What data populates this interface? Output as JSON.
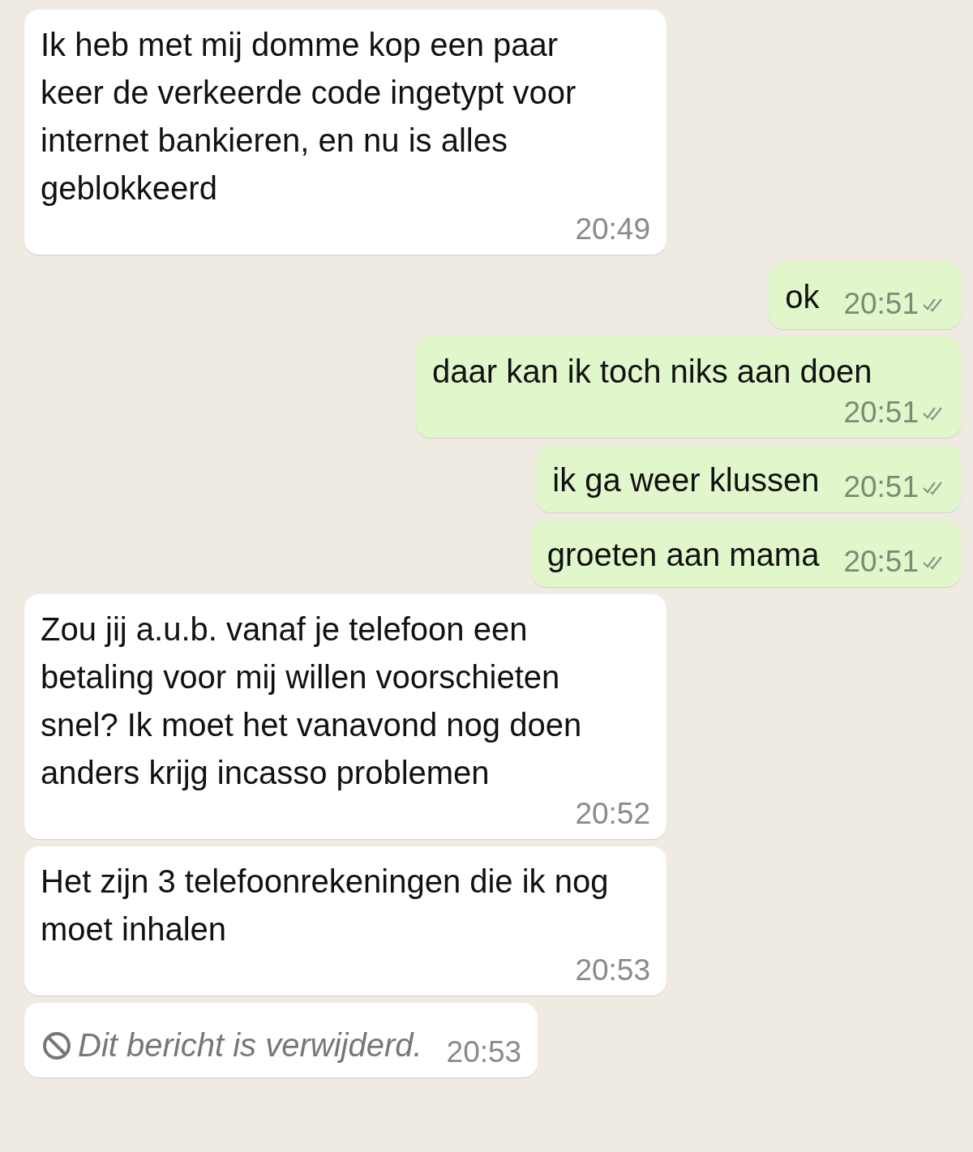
{
  "messages": [
    {
      "kind": "incoming",
      "text": "Ik heb met mij domme kop een paar keer de verkeerde code ingetypt voor internet bankieren, en nu is alles geblokkeerd",
      "time": "20:49"
    },
    {
      "kind": "outgoing",
      "text": "ok",
      "time": "20:51",
      "read": false
    },
    {
      "kind": "outgoing",
      "text": "daar kan ik toch niks aan doen",
      "time": "20:51",
      "read": false
    },
    {
      "kind": "outgoing",
      "text": "ik ga weer klussen",
      "time": "20:51",
      "read": false
    },
    {
      "kind": "outgoing",
      "text": "groeten aan mama",
      "time": "20:51",
      "read": false
    },
    {
      "kind": "incoming",
      "text": "Zou jij a.u.b. vanaf je telefoon een betaling voor mij willen voorschieten snel? Ik moet het vanavond nog doen anders krijg incasso problemen",
      "time": "20:52"
    },
    {
      "kind": "incoming",
      "text": "Het zijn 3 telefoonrekeningen die ik nog moet inhalen",
      "time": "20:53"
    },
    {
      "kind": "deleted",
      "text": "Dit bericht is verwijderd.",
      "time": "20:53"
    }
  ]
}
